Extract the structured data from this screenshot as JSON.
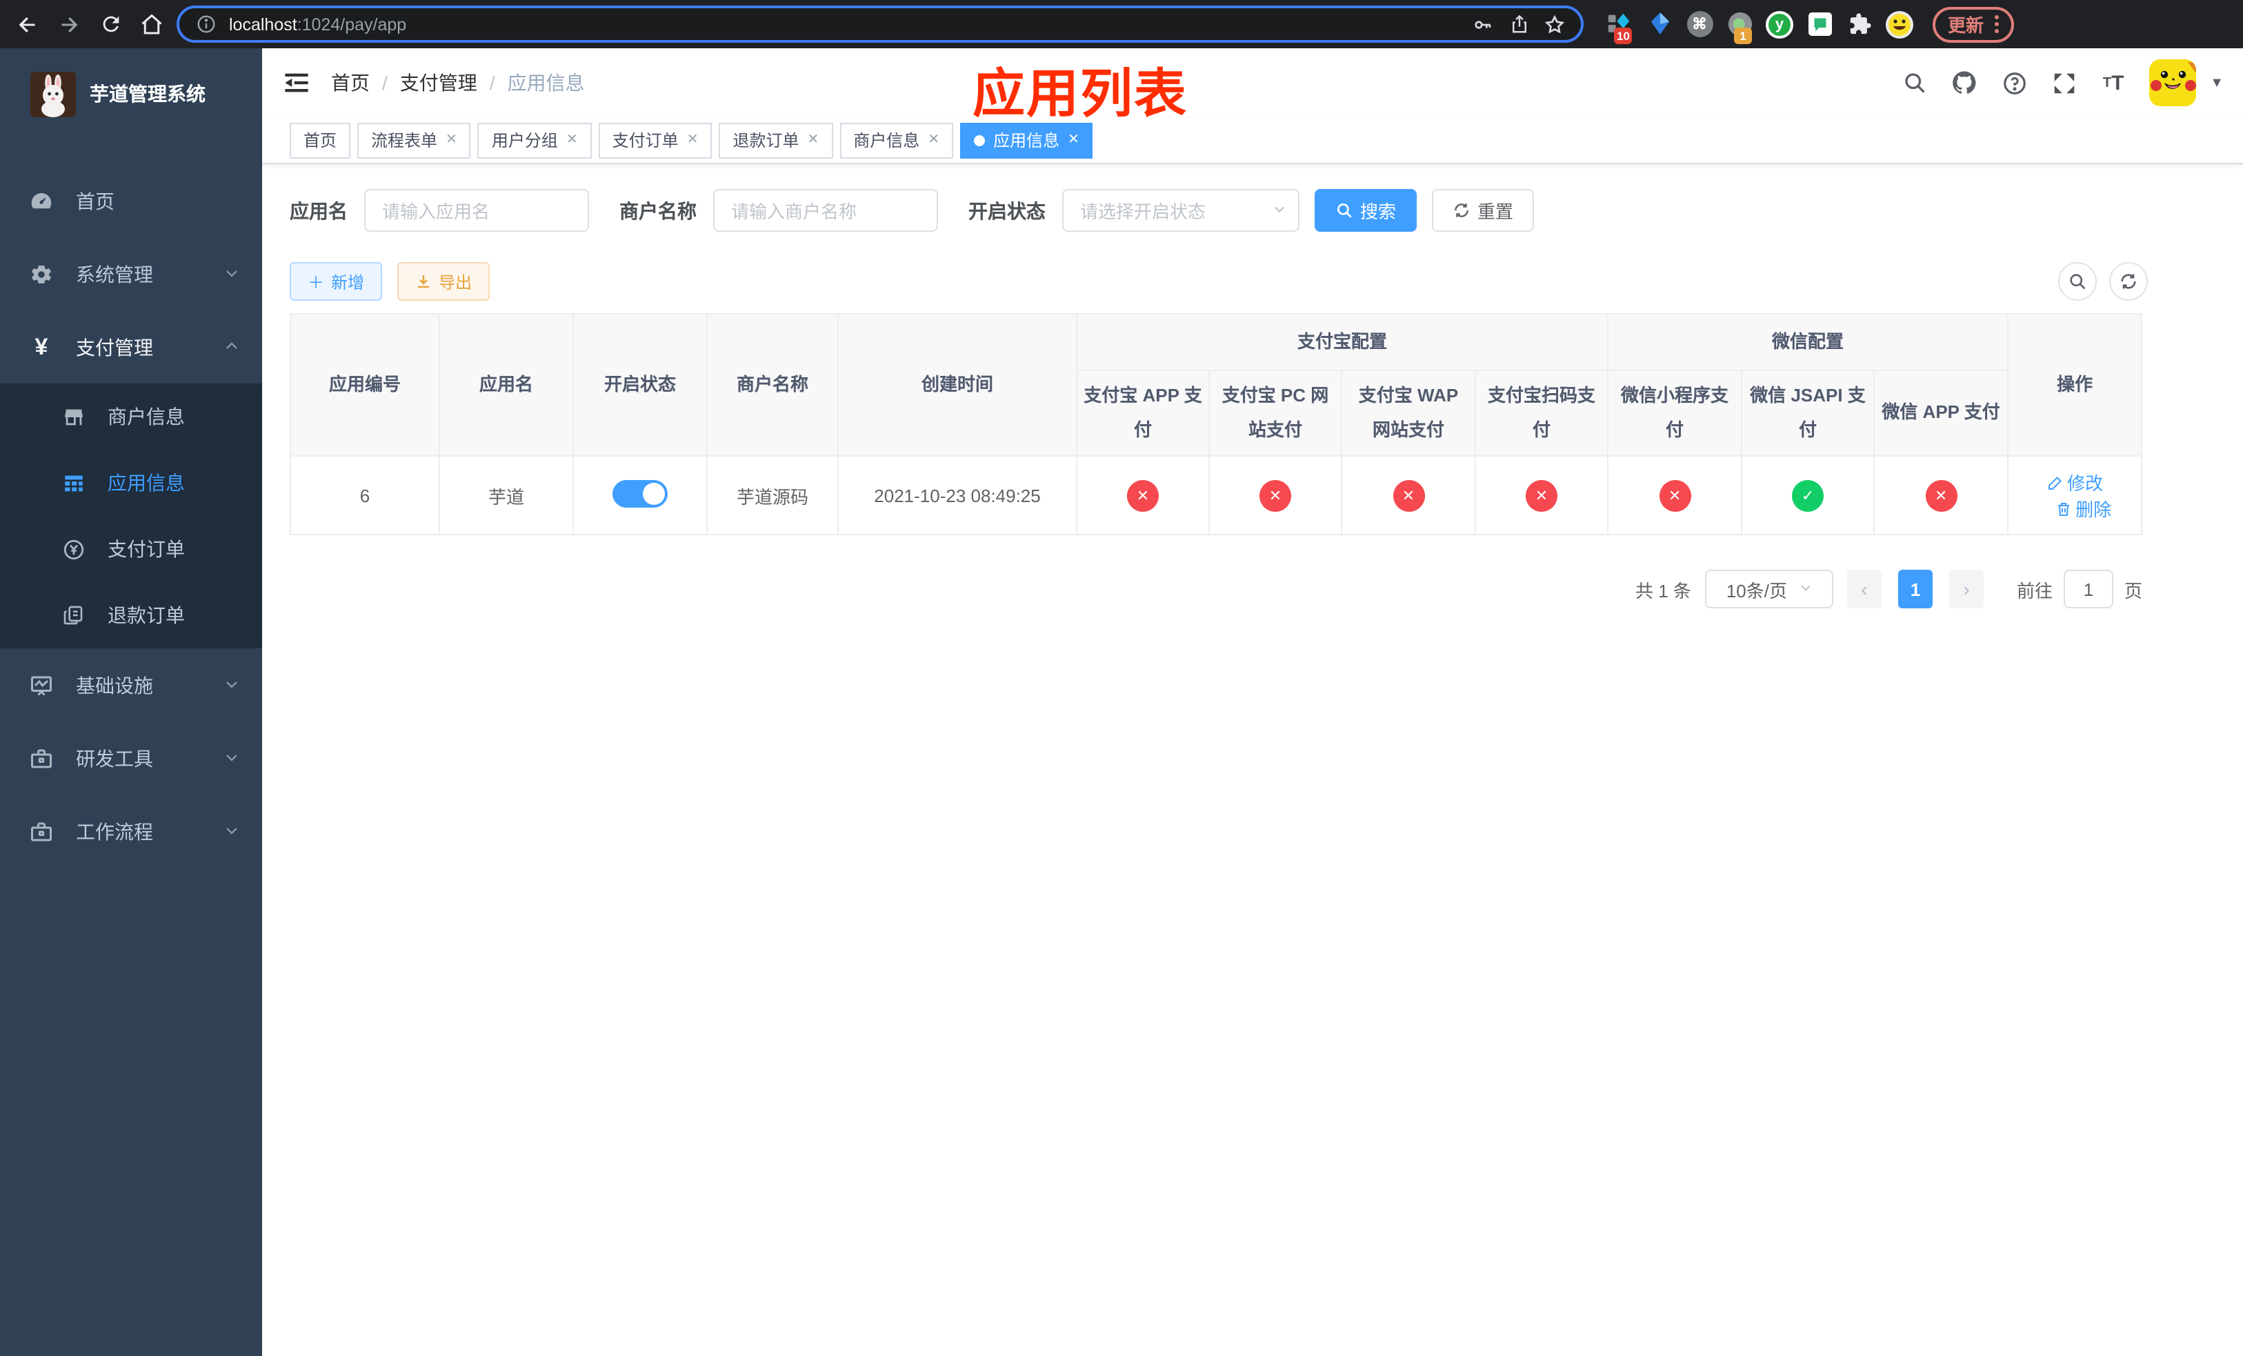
{
  "browser": {
    "url_host": "localhost",
    "url_path": ":1024/pay/app",
    "update_button": "更新",
    "ext_badge_grid": "10",
    "ext_badge_record": "1",
    "ext_y_letter": "y"
  },
  "sidebar": {
    "title": "芋道管理系统",
    "items": [
      {
        "label": "首页"
      },
      {
        "label": "系统管理"
      },
      {
        "label": "支付管理"
      },
      {
        "label": "商户信息"
      },
      {
        "label": "应用信息"
      },
      {
        "label": "支付订单"
      },
      {
        "label": "退款订单"
      },
      {
        "label": "基础设施"
      },
      {
        "label": "研发工具"
      },
      {
        "label": "工作流程"
      }
    ]
  },
  "navbar": {
    "breadcrumb": [
      {
        "label": "首页"
      },
      {
        "label": "支付管理"
      },
      {
        "label": "应用信息"
      }
    ]
  },
  "annotation": {
    "text": "应用列表"
  },
  "tabs": [
    {
      "label": "首页"
    },
    {
      "label": "流程表单"
    },
    {
      "label": "用户分组"
    },
    {
      "label": "支付订单"
    },
    {
      "label": "退款订单"
    },
    {
      "label": "商户信息"
    },
    {
      "label": "应用信息"
    }
  ],
  "search": {
    "app_name_label": "应用名",
    "app_name_placeholder": "请输入应用名",
    "merchant_label": "商户名称",
    "merchant_placeholder": "请输入商户名称",
    "status_label": "开启状态",
    "status_placeholder": "请选择开启状态",
    "search_button": "搜索",
    "reset_button": "重置"
  },
  "toolbar": {
    "add_button": "新增",
    "export_button": "导出"
  },
  "table": {
    "columns": [
      "应用编号",
      "应用名",
      "开启状态",
      "商户名称",
      "创建时间"
    ],
    "groups": [
      {
        "label": "支付宝配置",
        "children": [
          "支付宝 APP 支付",
          "支付宝 PC 网站支付",
          "支付宝 WAP 网站支付",
          "支付宝扫码支付"
        ]
      },
      {
        "label": "微信配置",
        "children": [
          "微信小程序支付",
          "微信 JSAPI 支付",
          "微信 APP 支付"
        ]
      }
    ],
    "actions_column": "操作",
    "row": {
      "id": "6",
      "name": "芋道",
      "enabled": true,
      "merchant": "芋道源码",
      "created_at": "2021-10-23 08:49:25",
      "statuses": [
        "cross",
        "cross",
        "cross",
        "cross",
        "cross",
        "check",
        "cross"
      ],
      "edit_label": "修改",
      "delete_label": "删除"
    }
  },
  "pagination": {
    "total": "共 1 条",
    "page_size": "10条/页",
    "current_page": "1",
    "goto_prefix": "前往",
    "goto_value": "1",
    "goto_suffix": "页"
  },
  "colors": {
    "accent": "#409eff",
    "danger": "#f5494f",
    "success": "#13ce66",
    "warning": "#e6a23c",
    "sidebar_bg": "#304156",
    "submenu_bg": "#1f2d3d",
    "annotation": "#ff2d00"
  }
}
